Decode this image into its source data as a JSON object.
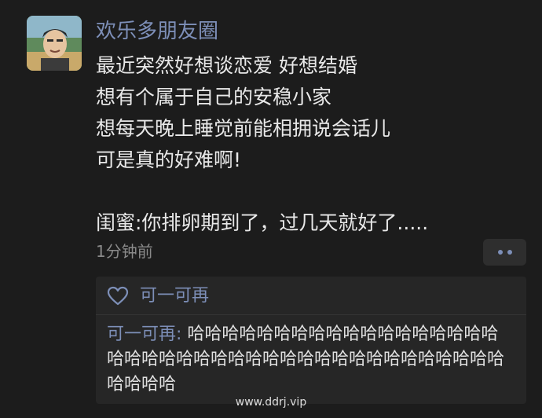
{
  "post": {
    "username": "欢乐多朋友圈",
    "lines": [
      "最近突然好想谈恋爱 好想结婚",
      "想有个属于自己的安稳小家",
      "想每天晚上睡觉前能相拥说会话儿",
      "可是真的好难啊!",
      "",
      "闺蜜:你排卵期到了，过几天就好了....."
    ],
    "timestamp": "1分钟前"
  },
  "likes": {
    "icon": "heart-outline-icon",
    "names": "可一可再"
  },
  "comment": {
    "author": "可一可再",
    "separator": ": ",
    "text": "哈哈哈哈哈哈哈哈哈哈哈哈哈哈哈哈哈哈哈哈哈哈哈哈哈哈哈哈哈哈哈哈哈哈哈哈哈哈哈哈哈哈哈哈哈"
  },
  "watermark": "www.ddrj.vip",
  "colors": {
    "background": "#1c1c1c",
    "accent": "#7d8fb8",
    "panel": "#262626",
    "text": "#e8e8e8",
    "muted": "#8a8a8a"
  }
}
